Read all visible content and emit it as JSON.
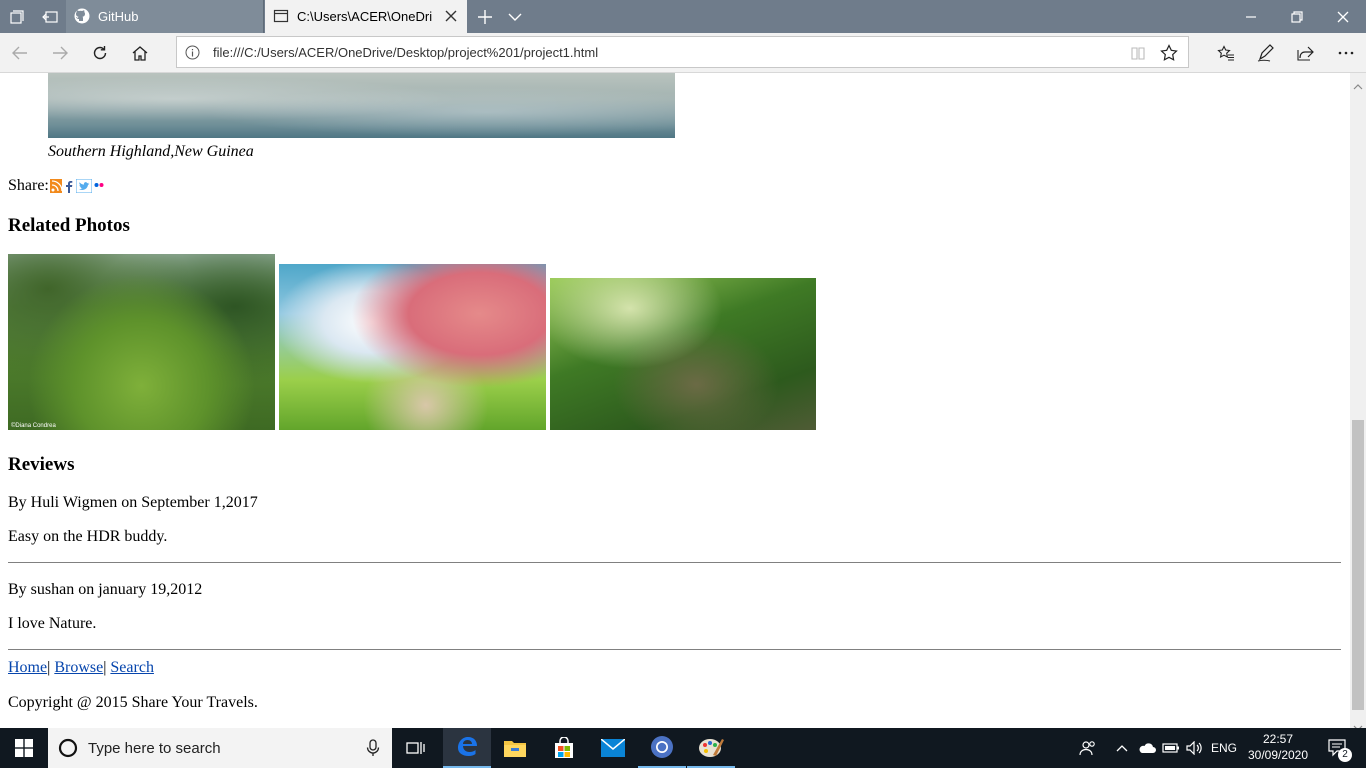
{
  "browser": {
    "tabs": [
      {
        "label": "GitHub",
        "icon": "github-icon",
        "active": false
      },
      {
        "label": "C:\\Users\\ACER\\OneDriv",
        "icon": "page-icon",
        "active": true
      }
    ],
    "address": "file:///C:/Users/ACER/OneDrive/Desktop/project%201/project1.html"
  },
  "page": {
    "caption": "Southern Highland,New Guinea",
    "share_label": "Share:",
    "share_icons": [
      "rss-icon",
      "facebook-icon",
      "twitter-icon",
      "flickr-icon"
    ],
    "related_heading": "Related Photos",
    "reviews_heading": "Reviews",
    "reviews": [
      {
        "byline": "By Huli Wigmen on September 1,2017",
        "text": "Easy on the HDR buddy."
      },
      {
        "byline": "By sushan on january 19,2012",
        "text": "I love Nature."
      }
    ],
    "footer_links": [
      "Home",
      "Browse",
      "Search"
    ],
    "footer_separator": "|",
    "copyright": "Copyright @ 2015 Share Your Travels.",
    "photo_credit": "©Diana Condrea"
  },
  "taskbar": {
    "search_placeholder": "Type here to search",
    "language": "ENG",
    "time": "22:57",
    "date": "30/09/2020",
    "notification_count": "2"
  },
  "colors": {
    "tab_strip": "#6f7c8b",
    "link": "#0645ad",
    "taskbar": "#101820",
    "edge_blue": "#1a73e8"
  }
}
